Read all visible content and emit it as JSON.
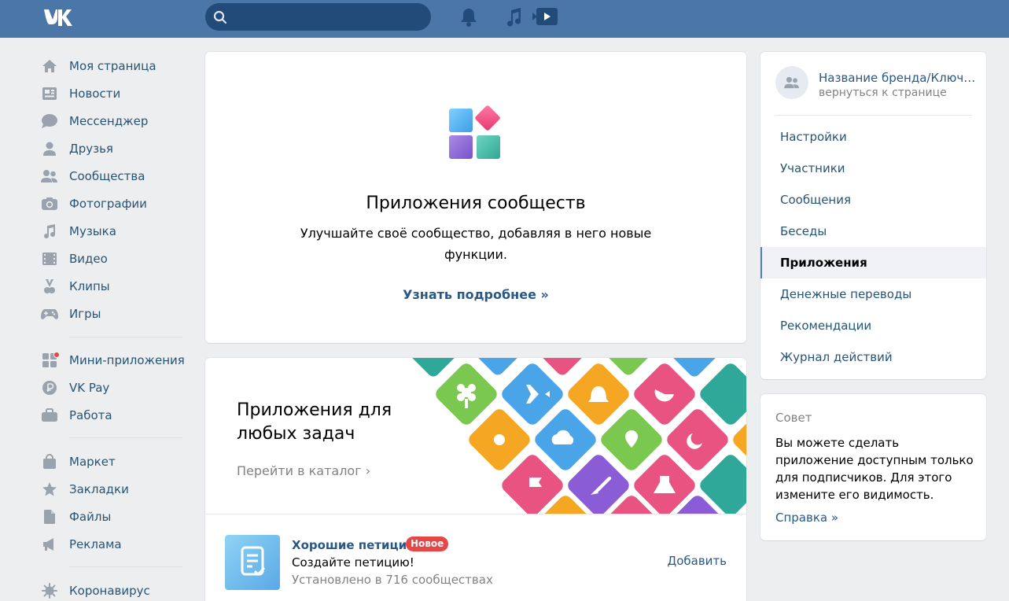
{
  "header": {
    "search_placeholder": ""
  },
  "leftnav": {
    "group1": [
      {
        "label": "Моя страница",
        "icon": "home-icon"
      },
      {
        "label": "Новости",
        "icon": "news-icon"
      },
      {
        "label": "Мессенджер",
        "icon": "chat-icon"
      },
      {
        "label": "Друзья",
        "icon": "user-icon"
      },
      {
        "label": "Сообщества",
        "icon": "users-icon"
      },
      {
        "label": "Фотографии",
        "icon": "camera-icon"
      },
      {
        "label": "Музыка",
        "icon": "music-icon"
      },
      {
        "label": "Видео",
        "icon": "film-icon"
      },
      {
        "label": "Клипы",
        "icon": "clips-icon"
      },
      {
        "label": "Игры",
        "icon": "gamepad-icon"
      }
    ],
    "group2": [
      {
        "label": "Мини-приложения",
        "icon": "apps-icon"
      },
      {
        "label": "VK Pay",
        "icon": "vkpay-icon"
      },
      {
        "label": "Работа",
        "icon": "briefcase-icon"
      }
    ],
    "group3": [
      {
        "label": "Маркет",
        "icon": "bag-icon"
      },
      {
        "label": "Закладки",
        "icon": "star-icon"
      },
      {
        "label": "Файлы",
        "icon": "file-icon"
      },
      {
        "label": "Реклама",
        "icon": "megaphone-icon"
      }
    ],
    "group4": [
      {
        "label": "Коронавирус",
        "icon": "virus-icon"
      }
    ]
  },
  "hero": {
    "title": "Приложения сообществ",
    "description": "Улучшайте своё сообщество, добавляя в него новые функции.",
    "link": "Узнать подробнее »"
  },
  "promo": {
    "title": "Приложения для любых задач",
    "link": "Перейти в каталог ›"
  },
  "app": {
    "name": "Хорошие петиции",
    "badge": "Новое",
    "subtitle": "Создайте петицию!",
    "installed": "Установлено в 716 сообществах",
    "add": "Добавить"
  },
  "owner": {
    "name": "Название бренда/Ключевое слово",
    "back": "вернуться к странице"
  },
  "rightmenu": [
    {
      "label": "Настройки",
      "active": false
    },
    {
      "label": "Участники",
      "active": false
    },
    {
      "label": "Сообщения",
      "active": false
    },
    {
      "label": "Беседы",
      "active": false
    },
    {
      "label": "Приложения",
      "active": true
    },
    {
      "label": "Денежные переводы",
      "active": false
    },
    {
      "label": "Рекомендации",
      "active": false
    },
    {
      "label": "Журнал действий",
      "active": false
    }
  ],
  "tip": {
    "heading": "Совет",
    "text": "Вы можете сделать приложение доступным только для подписчиков. Для этого измените его видимость.",
    "link": "Справка »"
  },
  "colors": {
    "header": "#4a76a8",
    "link": "#2a5885",
    "nav_text": "#285473",
    "icon": "#99a2ad",
    "badge": "#e64646"
  }
}
